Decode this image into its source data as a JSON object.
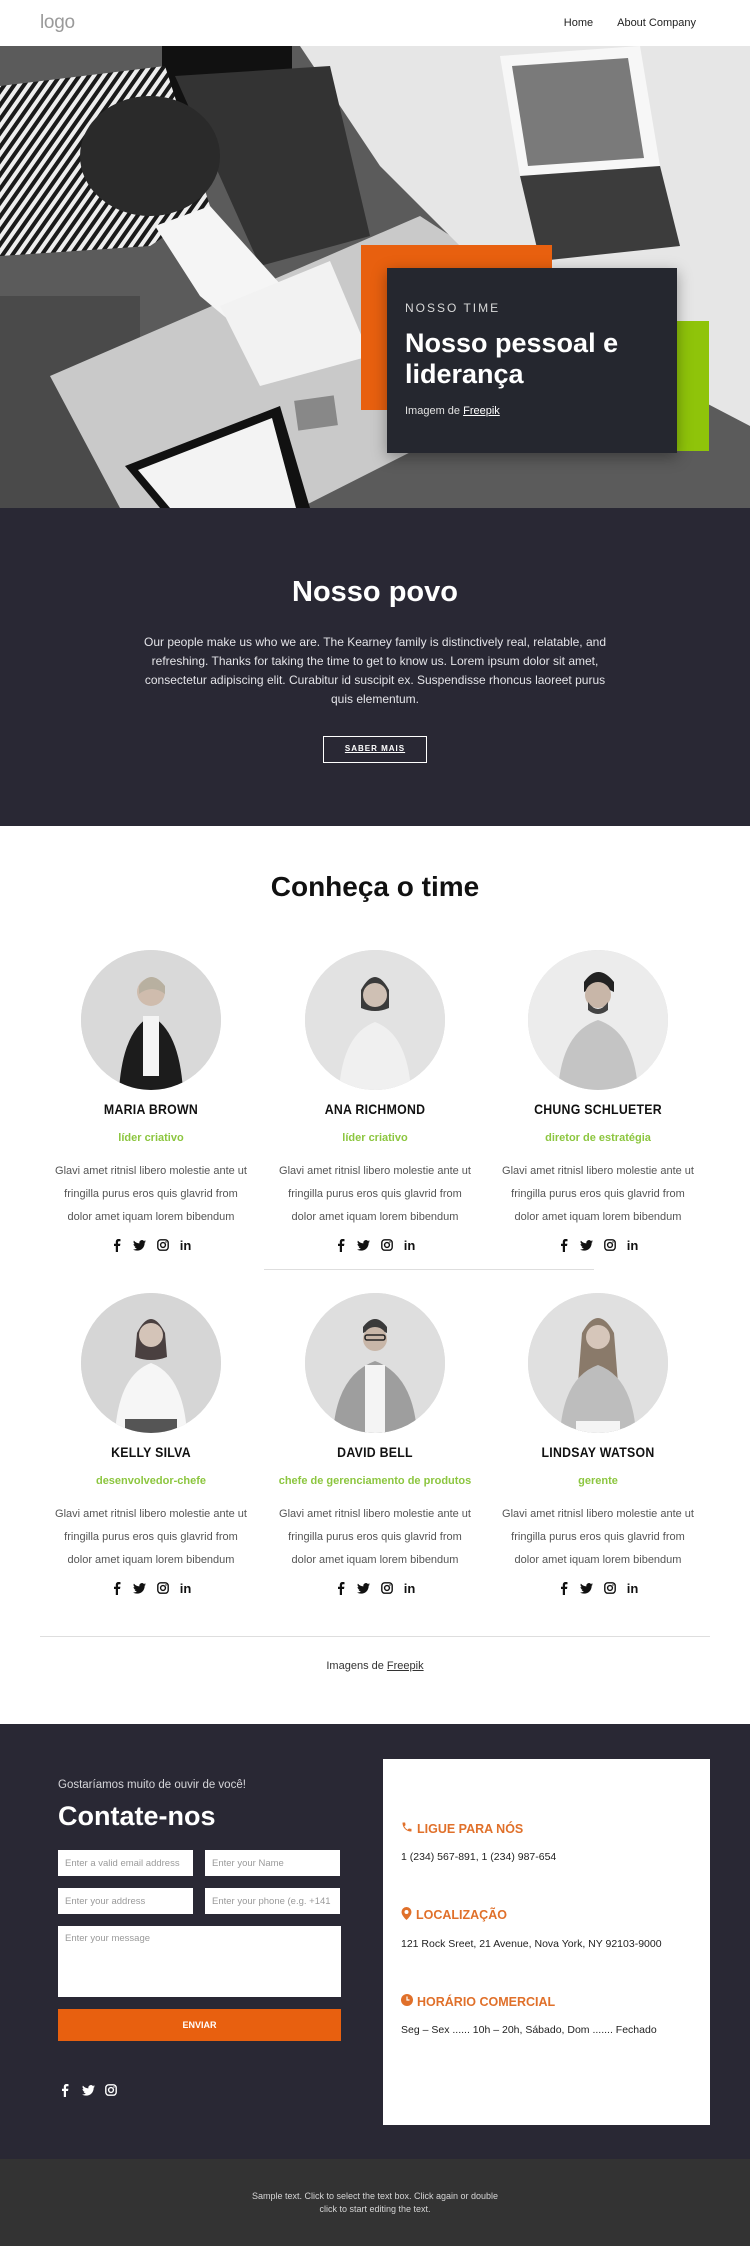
{
  "header": {
    "logo": "logo",
    "nav": [
      {
        "label": "Home"
      },
      {
        "label": "About Company"
      }
    ]
  },
  "hero": {
    "eyebrow": "NOSSO TIME",
    "title": "Nosso pessoal e liderança",
    "credit_prefix": "Imagem de",
    "credit_link": "Freepik",
    "colors": {
      "orange": "#e8600f",
      "green": "#8fc40a",
      "card": "#25272f"
    }
  },
  "povo": {
    "title": "Nosso povo",
    "text": "Our people make us who we are. The Kearney family is distinctively real, relatable, and refreshing. Thanks for taking the time to get to know us. Lorem ipsum dolor sit amet, consectetur adipiscing elit. Curabitur id suscipit ex. Suspendisse rhoncus laoreet purus quis elementum.",
    "button": "SABER MAIS"
  },
  "team": {
    "title": "Conheça o time",
    "members": [
      {
        "name": "MARIA BROWN",
        "role": "líder criativo",
        "bio": "Glavi amet ritnisl libero molestie ante ut fringilla purus eros quis glavrid from dolor amet iquam lorem bibendum"
      },
      {
        "name": "ANA RICHMOND",
        "role": "líder criativo",
        "bio": "Glavi amet ritnisl libero molestie ante ut fringilla purus eros quis glavrid from dolor amet iquam lorem bibendum"
      },
      {
        "name": "CHUNG SCHLUETER",
        "role": "diretor de estratégia",
        "bio": "Glavi amet ritnisl libero molestie ante ut fringilla purus eros quis glavrid from dolor amet iquam lorem bibendum"
      },
      {
        "name": "KELLY SILVA",
        "role": "desenvolvedor-chefe",
        "bio": "Glavi amet ritnisl libero molestie ante ut fringilla purus eros quis glavrid from dolor amet iquam lorem bibendum"
      },
      {
        "name": "DAVID BELL",
        "role": "chefe de gerenciamento de produtos",
        "bio": "Glavi amet ritnisl libero molestie ante ut fringilla purus eros quis glavrid from dolor amet iquam lorem bibendum"
      },
      {
        "name": "LINDSAY WATSON",
        "role": "gerente",
        "bio": "Glavi amet ritnisl libero molestie ante ut fringilla purus eros quis glavrid from dolor amet iquam lorem bibendum"
      }
    ],
    "social_icons": [
      "facebook-icon",
      "twitter-icon",
      "instagram-icon",
      "linkedin-icon"
    ],
    "credit_prefix": "Imagens de",
    "credit_link": "Freepik",
    "role_color": "#8cc63f"
  },
  "contact": {
    "eyebrow": "Gostaríamos muito de ouvir de você!",
    "title": "Contate-nos",
    "fields": {
      "email_placeholder": "Enter a valid email address",
      "name_placeholder": "Enter your Name",
      "address_placeholder": "Enter your address",
      "phone_placeholder": "Enter your phone (e.g. +141",
      "message_placeholder": "Enter your message"
    },
    "submit": "ENVIAR",
    "social_icons": [
      "facebook-icon",
      "twitter-icon",
      "instagram-icon"
    ],
    "info": [
      {
        "icon": "phone-icon",
        "title": "LIGUE PARA NÓS",
        "text": "1 (234) 567-891, 1 (234) 987-654"
      },
      {
        "icon": "location-pin-icon",
        "title": "LOCALIZAÇÃO",
        "text": "121 Rock Sreet, 21 Avenue, Nova York, NY 92103-9000"
      },
      {
        "icon": "clock-icon",
        "title": "HORÁRIO COMERCIAL",
        "text": "Seg – Sex ...... 10h – 20h, Sábado, Dom ....... Fechado"
      }
    ],
    "accent": "#e0702a"
  },
  "footer": {
    "text": "Sample text. Click to select the text box. Click again or double click to start editing the text."
  }
}
